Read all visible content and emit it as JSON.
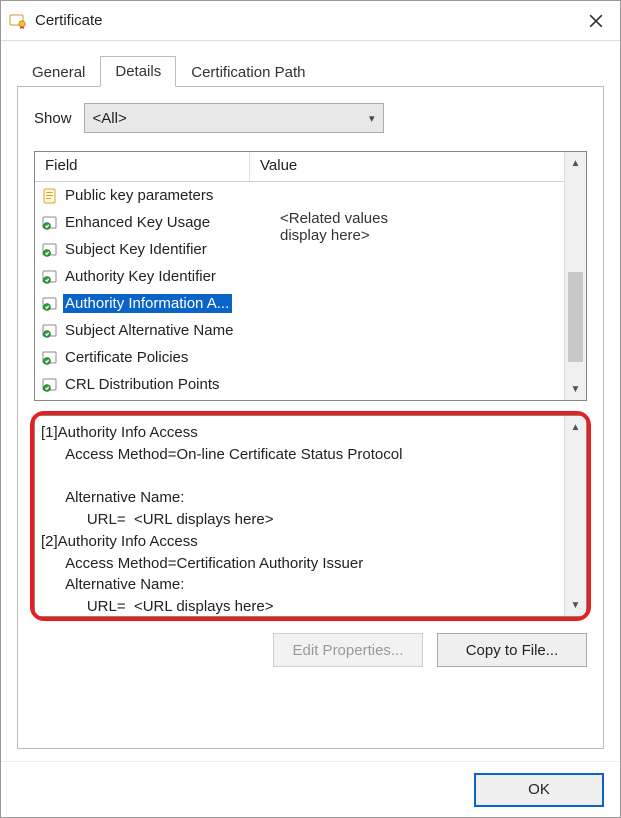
{
  "window": {
    "title": "Certificate"
  },
  "tabs": {
    "items": [
      "General",
      "Details",
      "Certification Path"
    ],
    "active_index": 1
  },
  "details": {
    "show_label": "Show",
    "show_value": "<All>",
    "columns": {
      "field": "Field",
      "value": "Value"
    },
    "value_placeholder": "<Related values\ndisplay here>",
    "rows": [
      {
        "field": "Public key parameters",
        "icon": "page-icon",
        "selected": false
      },
      {
        "field": "Enhanced Key Usage",
        "icon": "ext-icon",
        "selected": false
      },
      {
        "field": "Subject Key Identifier",
        "icon": "ext-icon",
        "selected": false
      },
      {
        "field": "Authority Key Identifier",
        "icon": "ext-icon",
        "selected": false
      },
      {
        "field": "Authority Information A...",
        "icon": "ext-icon",
        "selected": true
      },
      {
        "field": "Subject Alternative Name",
        "icon": "ext-icon",
        "selected": false
      },
      {
        "field": "Certificate Policies",
        "icon": "ext-icon",
        "selected": false
      },
      {
        "field": "CRL Distribution Points",
        "icon": "ext-icon",
        "selected": false
      }
    ],
    "detail_text": "[1]Authority Info Access\n      Access Method=On-line Certificate Status Protocol\n\n      Alternative Name:\n           URL=  <URL displays here>\n[2]Authority Info Access\n      Access Method=Certification Authority Issuer\n      Alternative Name:\n           URL=  <URL displays here>",
    "buttons": {
      "edit": "Edit Properties...",
      "copy": "Copy to File..."
    }
  },
  "footer": {
    "ok": "OK"
  },
  "colors": {
    "select": "#0a63c9",
    "highlight": "#e62020"
  }
}
